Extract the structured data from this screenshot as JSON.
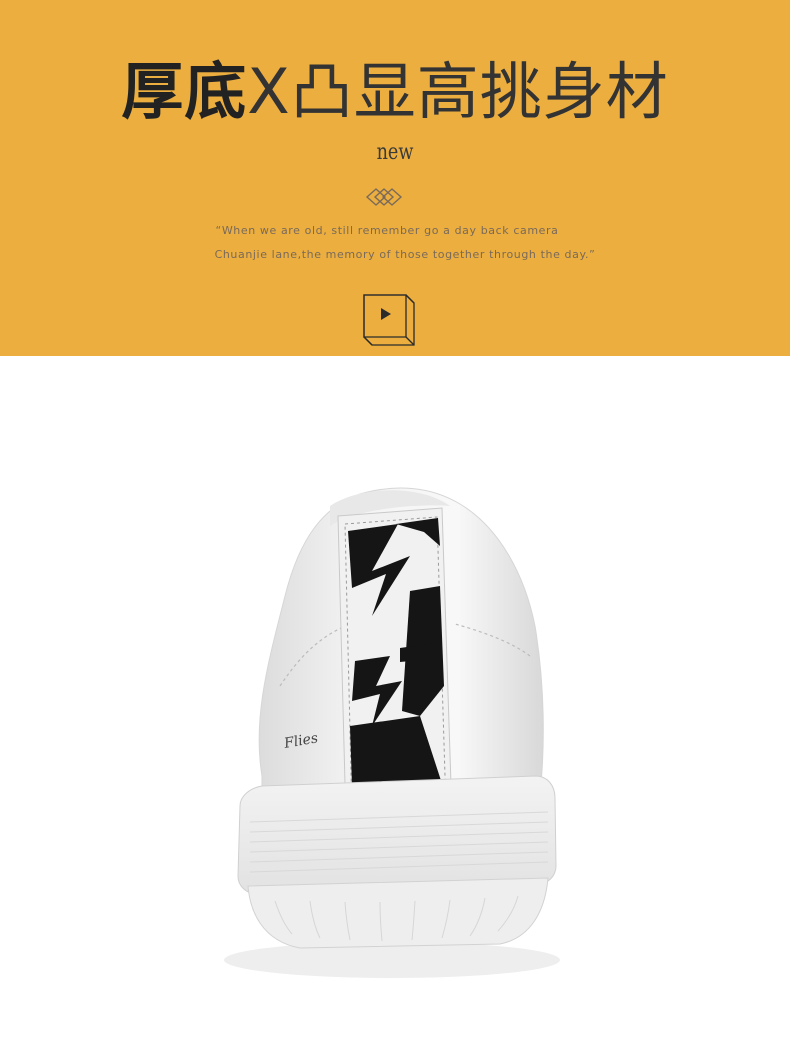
{
  "banner": {
    "headline_bold": "厚底",
    "headline_rest": "X凸显高挑身材",
    "new_label": "new",
    "quote_line1": "“When we are old, still remember go a day back camera",
    "quote_line2": "Chuanjie lane,the memory of those together through the day.”",
    "background_color": "#ebae3f"
  },
  "icons": {
    "divider": "double-diamond-icon",
    "play": "play-icon"
  },
  "product": {
    "image": "white-sneaker-heel-view"
  }
}
